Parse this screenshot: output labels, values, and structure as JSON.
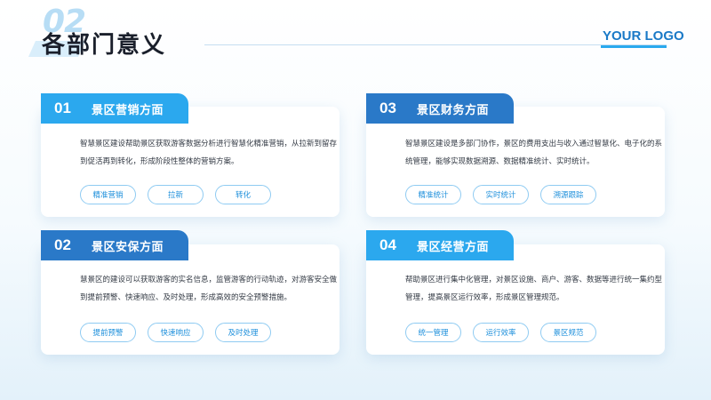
{
  "header": {
    "number": "02",
    "title": "各部门意义",
    "logo": "YOUR LOGO"
  },
  "colors": {
    "light_blue": "#2ba8ee",
    "dark_blue": "#2a79c8",
    "tag_border": "#8fcbf2",
    "tag_text": "#1d8fdb"
  },
  "cards": [
    {
      "num": "01",
      "title": "景区营销方面",
      "desc": "智慧景区建设帮助景区获取游客数据分析进行智慧化精准营销，从拉新到留存到促活再到转化，形成阶段性整体的营销方案。",
      "tags": [
        "精准营销",
        "拉新",
        "转化"
      ]
    },
    {
      "num": "03",
      "title": "景区财务方面",
      "desc": "智慧景区建设是多部门协作，景区的费用支出与收入通过智慧化、电子化的系统管理，能够实现数据溯源、数据精准统计、实时统计。",
      "tags": [
        "精准统计",
        "实时统计",
        "溯源跟踪"
      ]
    },
    {
      "num": "02",
      "title": "景区安保方面",
      "desc": "慧景区的建设可以获取游客的实名信息，监管游客的行动轨迹，对游客安全做到提前预警、快速响应、及时处理，形成高效的安全预警措施。",
      "tags": [
        "提前预警",
        "快速响应",
        "及时处理"
      ]
    },
    {
      "num": "04",
      "title": "景区经营方面",
      "desc": "帮助景区进行集中化管理，对景区设施、商户、游客、数据等进行统一集约型管理，提高景区运行效率，形成景区管理规范。",
      "tags": [
        "统一管理",
        "运行效率",
        "景区规范"
      ]
    }
  ]
}
